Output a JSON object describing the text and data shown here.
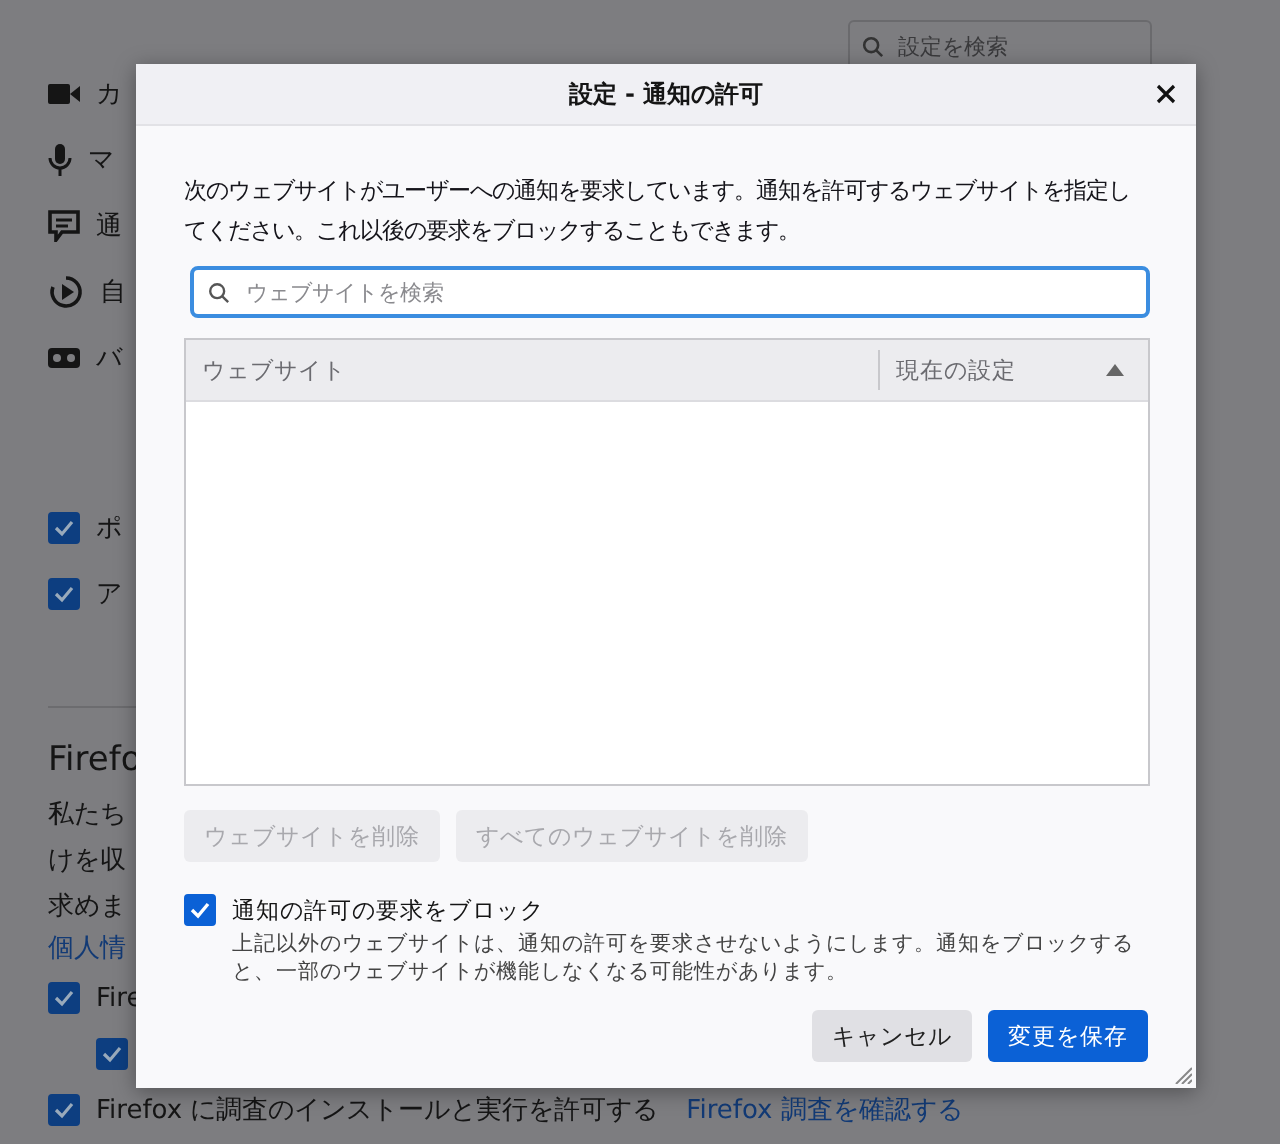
{
  "background": {
    "search": {
      "placeholder": "設定を検索"
    },
    "permissions": [
      {
        "kind": "camera",
        "label": "カ"
      },
      {
        "kind": "microphone",
        "label": "マ"
      },
      {
        "kind": "notification",
        "label": "通"
      },
      {
        "kind": "autoplay",
        "label": "自"
      },
      {
        "kind": "vr",
        "label": "バ"
      }
    ],
    "block_options": [
      {
        "label": "ポ",
        "checked": true
      },
      {
        "label": "ア",
        "checked": true
      }
    ],
    "section_title": "Firefo",
    "paragraph_lines": [
      "私たち",
      "けを収",
      "求めま"
    ],
    "link": "個人情",
    "data_options": [
      {
        "label": "Fire",
        "checked": true,
        "children": [
          {
            "checked": true
          }
        ]
      },
      {
        "label": "Firefox に調査のインストールと実行を許可する",
        "checked": true,
        "link": "Firefox 調査を確認する"
      }
    ]
  },
  "dialog": {
    "title": "設定 - 通知の許可",
    "description": "次のウェブサイトがユーザーへの通知を要求しています。通知を許可するウェブサイトを指定してください。これ以後の要求をブロックすることもできます。",
    "search": {
      "placeholder": "ウェブサイトを検索"
    },
    "table": {
      "columns": [
        {
          "label": "ウェブサイト",
          "sorted_ascending": false
        },
        {
          "label": "現在の設定",
          "sorted_ascending": true
        }
      ]
    },
    "list_buttons": [
      {
        "label": "ウェブサイトを削除",
        "disabled": true
      },
      {
        "label": "すべてのウェブサイトを削除",
        "disabled": true
      }
    ],
    "block_requests": {
      "label": "通知の許可の要求をブロック",
      "checked": true,
      "note": "上記以外のウェブサイトは、通知の許可を要求させないようにします。通知をブロックすると、一部のウェブサイトが機能しなくなる可能性があります。"
    },
    "buttons": [
      {
        "label": "キャンセル",
        "kind": "secondary"
      },
      {
        "label": "変更を保存",
        "kind": "primary"
      }
    ]
  }
}
